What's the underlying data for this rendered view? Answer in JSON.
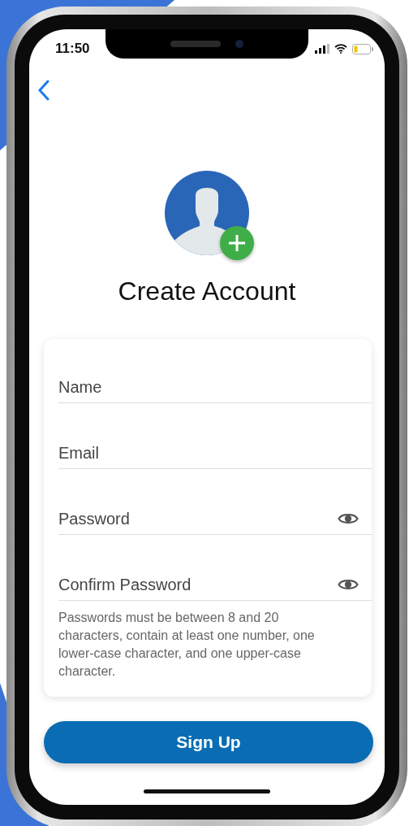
{
  "status_bar": {
    "time": "11:50"
  },
  "title": "Create Account",
  "fields": [
    {
      "kind": "text",
      "placeholder": "Name"
    },
    {
      "kind": "text",
      "placeholder": "Email"
    },
    {
      "kind": "password",
      "placeholder": "Password"
    },
    {
      "kind": "password",
      "placeholder": "Confirm Password"
    }
  ],
  "hint": "Passwords must be between 8 and 20 characters, contain at least one number, one lower-case character, and one upper-case character.",
  "button": "Sign Up"
}
